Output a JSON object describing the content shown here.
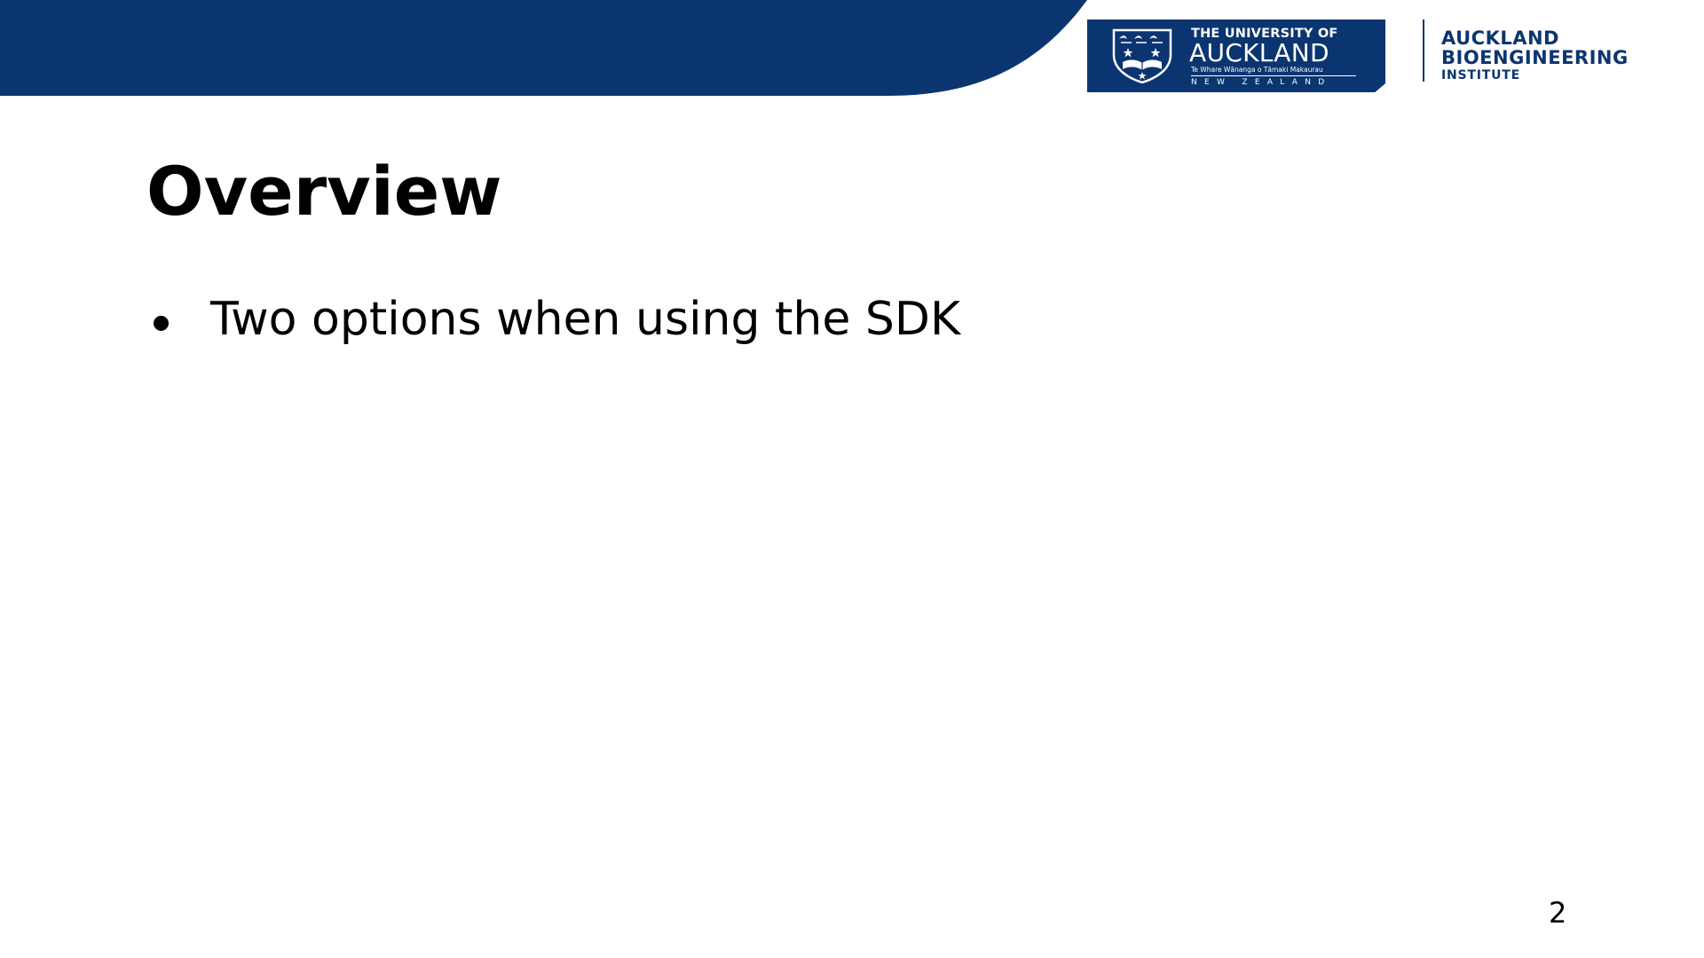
{
  "colors": {
    "brand": "#0b3570",
    "text": "#000000",
    "background": "#ffffff"
  },
  "header": {
    "university_logo": {
      "line1": "THE UNIVERSITY OF",
      "line2": "AUCKLAND",
      "line3": "Te Whare Wānanga o Tāmaki Makaurau",
      "line4": "NEW ZEALAND",
      "crest_icon": "university-crest"
    },
    "institute_logo": {
      "line1": "AUCKLAND",
      "line2": "BIOENGINEERING",
      "line3": "INSTITUTE"
    }
  },
  "slide": {
    "title": "Overview",
    "bullets": [
      {
        "text": "Two options when using the SDK"
      }
    ],
    "page_number": "2"
  }
}
